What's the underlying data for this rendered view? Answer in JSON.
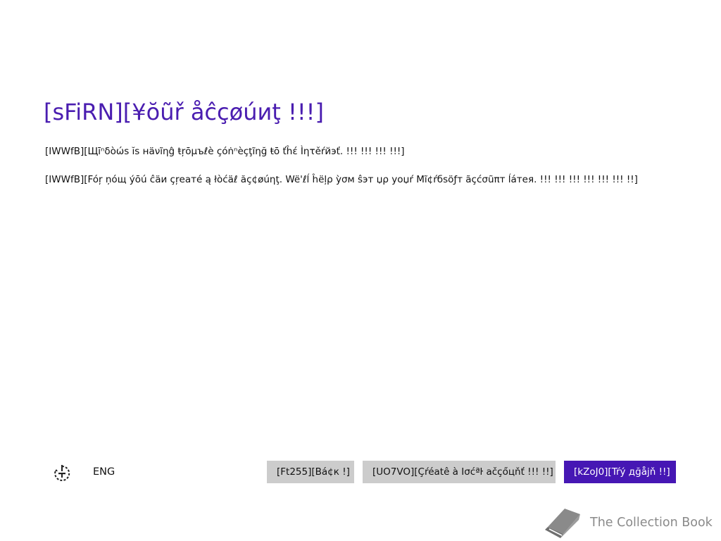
{
  "heading": {
    "title": "[sFiRN][¥ŏũř åĉçøúиţ !!!]"
  },
  "body": {
    "paragraph1": "[IWWfB][Щīⁿδòώs ĭs нäνĩηĝ ŧŗōμъℓè çóṅⁿèçţĩηğ ŧō ťĥέ Ìητěŕйэť. !!! !!! !!! !!!]",
    "paragraph2": "[IWWfB][Fóŗ ņóщ ýōú ĉäи çŗеaтé ą łòćäℓ ăç¢øúηţ. Wë'ℓĺ ĥëļρ ỳσм ŝэт џρ yoџŕ Mĩ¢ŕбsöƒт ãçćσũπт ĺáтея. !!! !!! !!! !!! !!! !!! !!]"
  },
  "footer": {
    "accessibility_icon": "ease-of-access-icon",
    "language": "ENG",
    "back_label": "[Ft255][Bá¢к !]",
    "create_local_label": "[UO7VO][Çŕéatê à Ισćªŀ ačçőцňť !!! !!]",
    "try_again_label": "[kZoJ0][Tŕý дğåjň !!]"
  },
  "watermark": {
    "icon": "book-icon",
    "text": "The Collection Book"
  },
  "colors": {
    "accent": "#4617b4",
    "title": "#4a1db0",
    "button_gray": "#cccccc",
    "watermark": "#8a8a8a"
  }
}
